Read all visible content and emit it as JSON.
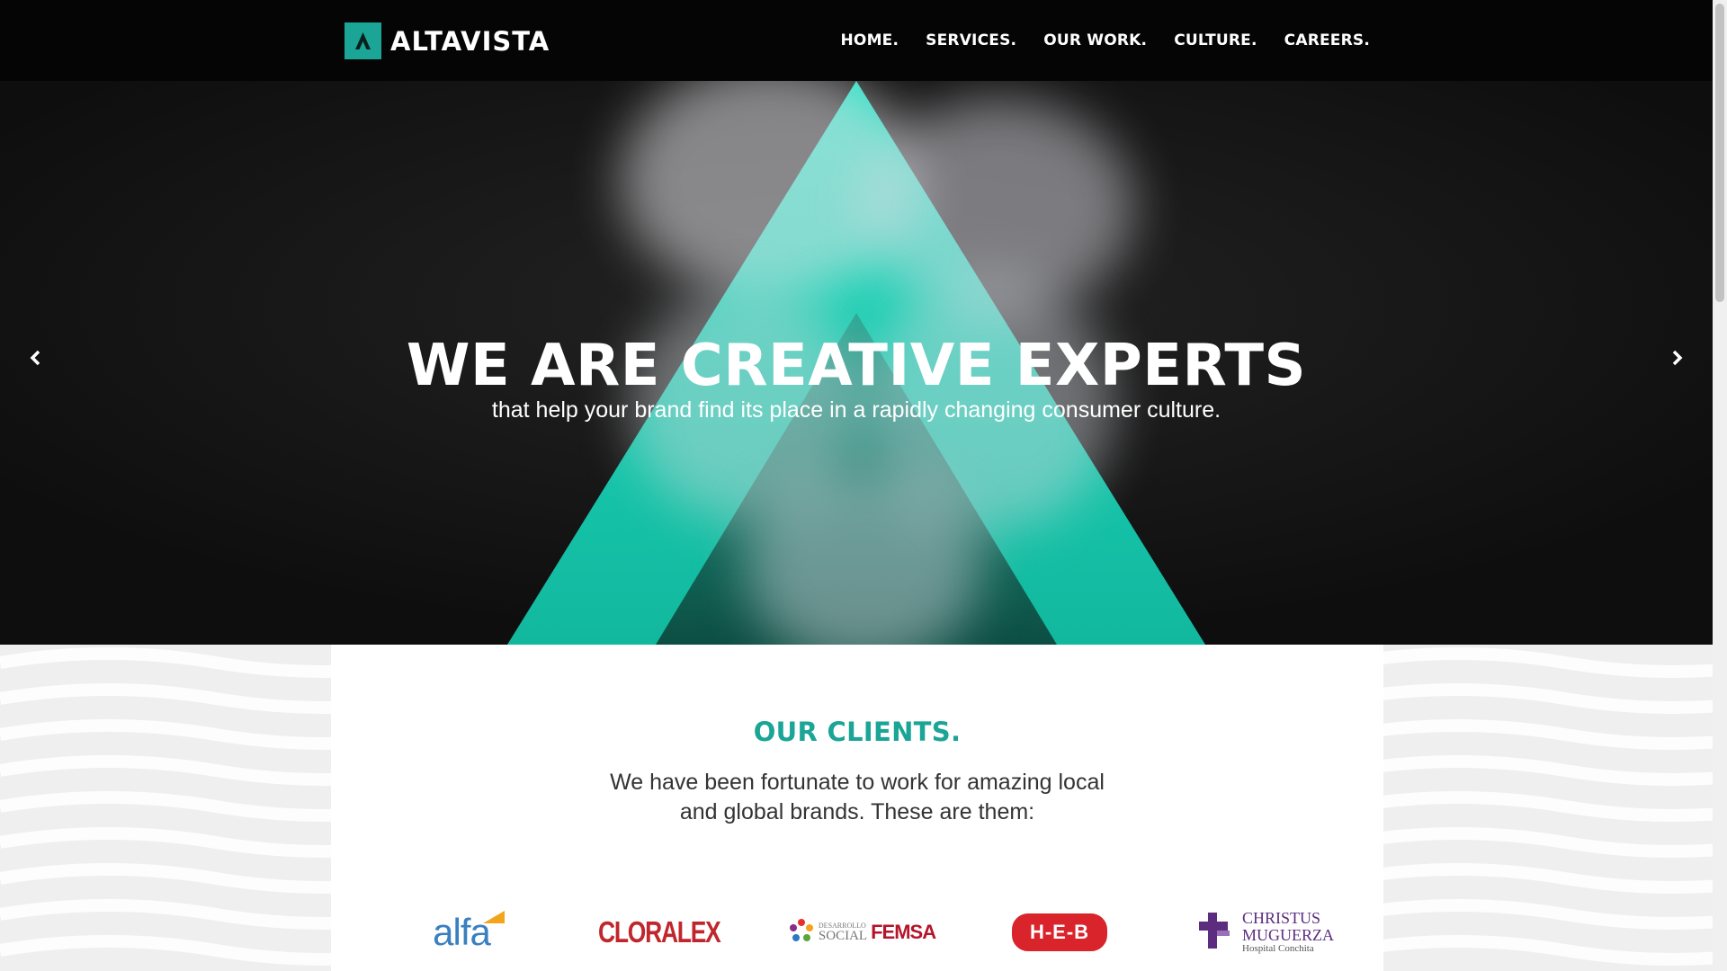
{
  "brand": {
    "name": "ALTAVISTA",
    "accent_color": "#1aa596"
  },
  "nav": {
    "items": [
      {
        "label": "HOME."
      },
      {
        "label": "SERVICES."
      },
      {
        "label": "OUR WORK."
      },
      {
        "label": "CULTURE."
      },
      {
        "label": "CAREERS."
      }
    ]
  },
  "hero": {
    "title": "WE ARE CREATIVE EXPERTS",
    "subtitle": "that help your brand find its place in a rapidly changing consumer culture.",
    "prev_icon": "chevron-left-icon",
    "next_icon": "chevron-right-icon"
  },
  "clients": {
    "title": "OUR CLIENTS.",
    "text": "We have been fortunate to work for amazing local and global brands. These are them:",
    "logos": [
      {
        "name": "alfa",
        "color": "#3a7fc1"
      },
      {
        "name": "CLORALEX",
        "color": "#c0262d"
      },
      {
        "name": "DESARROLLO SOCIAL FEMSA",
        "line1": "DESARROLLO",
        "line2": "SOCIAL",
        "line3": "FEMSA",
        "color": "#b5152b"
      },
      {
        "name": "H-E-B",
        "color": "#d9242b"
      },
      {
        "name": "CHRISTUS MUGUERZA",
        "line1": "CHRISTUS",
        "line2": "MUGUERZA",
        "line3": "Hospital Conchita",
        "color": "#5c2d7f"
      }
    ]
  }
}
